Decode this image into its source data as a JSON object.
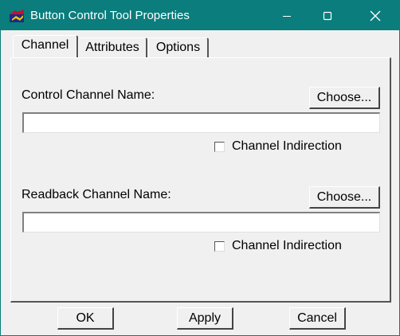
{
  "window": {
    "title": "Button Control Tool Properties",
    "titlebar_color": "#0a7d7c"
  },
  "tabs": [
    {
      "label": "Channel",
      "active": true
    },
    {
      "label": "Attributes",
      "active": false
    },
    {
      "label": "Options",
      "active": false
    }
  ],
  "control": {
    "label": "Control Channel Name:",
    "choose_label": "Choose...",
    "value": "",
    "indirection_label": "Channel Indirection",
    "indirection_checked": false
  },
  "readback": {
    "label": "Readback Channel Name:",
    "choose_label": "Choose...",
    "value": "",
    "indirection_label": "Channel Indirection",
    "indirection_checked": false
  },
  "footer": {
    "ok_label": "OK",
    "apply_label": "Apply",
    "cancel_label": "Cancel"
  }
}
